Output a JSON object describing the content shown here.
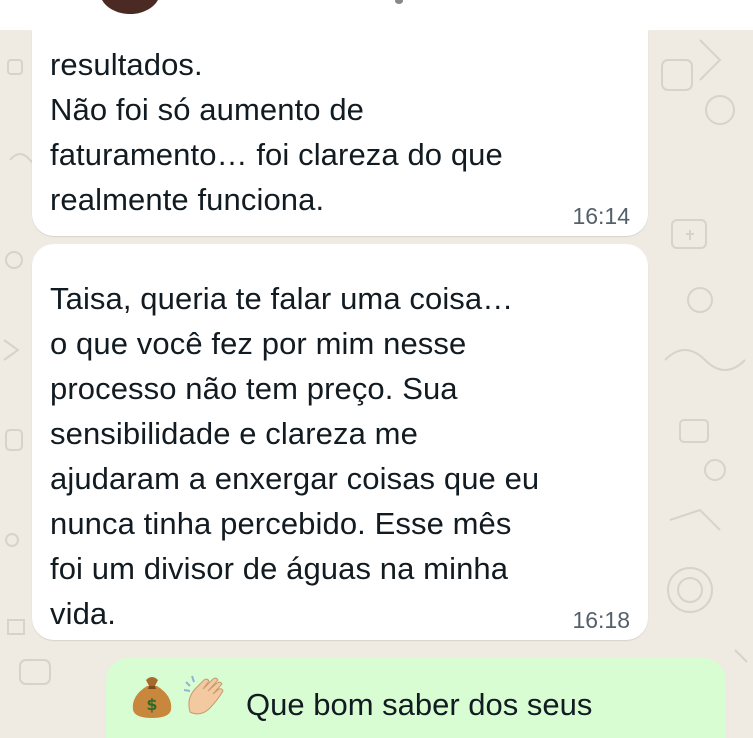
{
  "colors": {
    "background": "#efeae2",
    "incoming_bubble": "#ffffff",
    "outgoing_bubble": "#d9fdd3",
    "text": "#111b21",
    "time": "#55606a"
  },
  "messages": [
    {
      "direction": "incoming",
      "text": "resultados.\nNão foi só aumento de\nfaturamento… foi clareza do que\nrealmente funciona.",
      "time": "16:14"
    },
    {
      "direction": "incoming",
      "text": "Taisa, queria te falar uma coisa…\no que você fez por mim nesse\nprocesso não tem preço. Sua\nsensibilidade e clareza me\najudaram a enxergar coisas que eu\nnunca tinha percebido. Esse mês\nfoi um divisor de águas na minha\nvida.",
      "time": "16:18"
    },
    {
      "direction": "outgoing",
      "emojis": [
        "money-bag-icon",
        "clapping-hands-icon"
      ],
      "text": "Que bom saber dos seus"
    }
  ]
}
